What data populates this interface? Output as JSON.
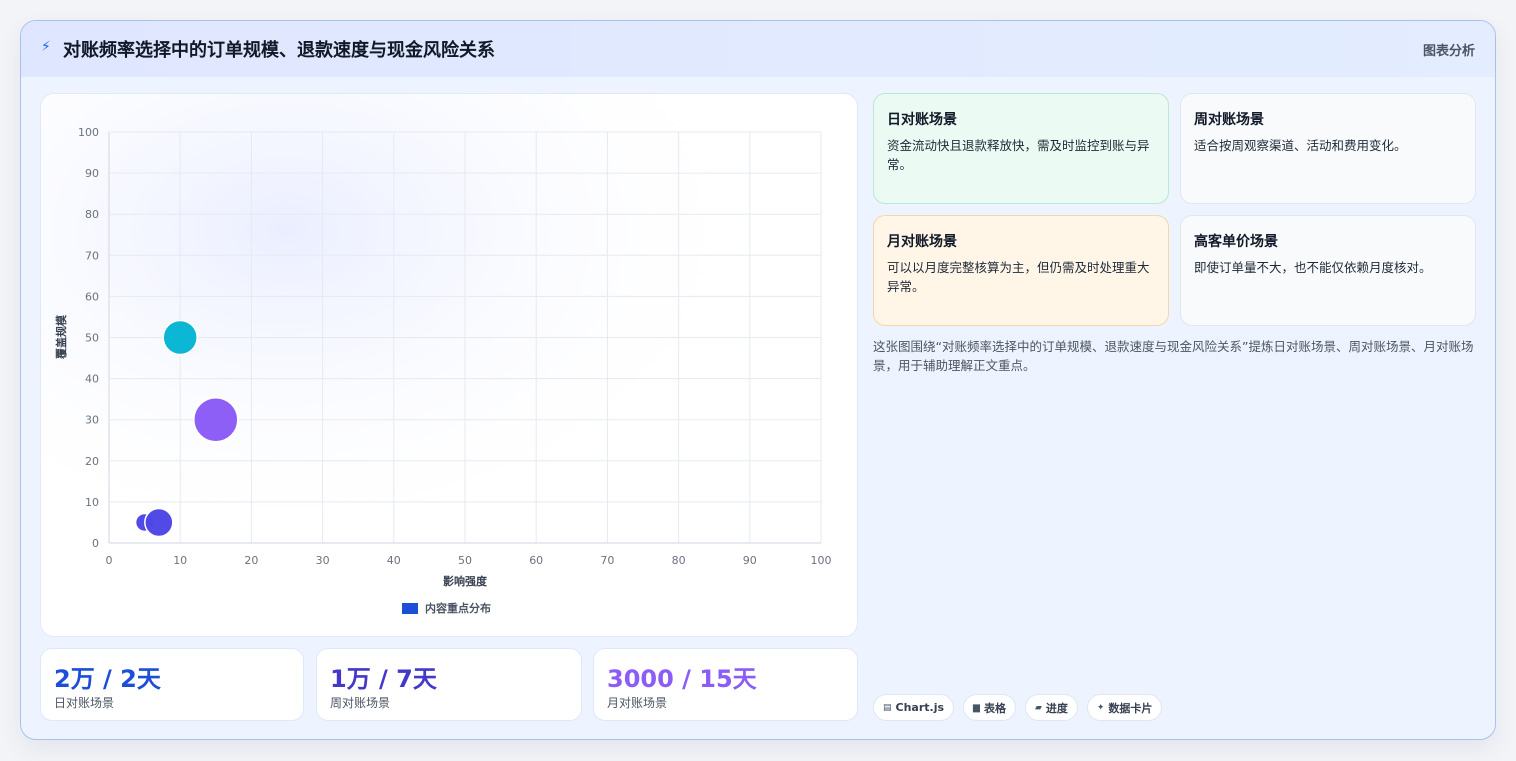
{
  "header": {
    "icon": "lightning-icon",
    "title": "对账频率选择中的订单规模、退款速度与现金风险关系",
    "badge": "图表分析"
  },
  "chart_data": {
    "type": "scatter",
    "xlabel": "影响强度",
    "ylabel": "覆盖规模",
    "xlim": [
      0,
      100
    ],
    "ylim": [
      0,
      100
    ],
    "xticks": [
      "0",
      "10",
      "20",
      "30",
      "40",
      "50",
      "60",
      "70",
      "80",
      "90",
      "100"
    ],
    "yticks": [
      "0",
      "10",
      "20",
      "30",
      "40",
      "50",
      "60",
      "70",
      "80",
      "90",
      "100"
    ],
    "grid": true,
    "legend_position": "bottom",
    "series": [
      {
        "name": "内容重点分布",
        "legend_color": "#1d4ed8",
        "points": [
          {
            "x": 5,
            "y": 5,
            "r": 9,
            "color": "#4f46e5"
          },
          {
            "x": 7,
            "y": 5,
            "r": 14,
            "color": "#4f46e5"
          },
          {
            "x": 10,
            "y": 50,
            "r": 17,
            "color": "#06b6d4"
          },
          {
            "x": 15,
            "y": 30,
            "r": 22,
            "color": "#8b5cf6"
          }
        ]
      }
    ]
  },
  "stats": [
    {
      "value": "2万 / 2天",
      "label": "日对账场景",
      "color": "#1d4ed8"
    },
    {
      "value": "1万 / 7天",
      "label": "周对账场景",
      "color": "#4338ca"
    },
    {
      "value": "3000 / 15天",
      "label": "月对账场景",
      "color": "#8b5cf6"
    }
  ],
  "scenes": [
    {
      "title": "日对账场景",
      "desc": "资金流动快且退款释放快，需及时监控到账与异常。"
    },
    {
      "title": "周对账场景",
      "desc": "适合按周观察渠道、活动和费用变化。"
    },
    {
      "title": "月对账场景",
      "desc": "可以以月度完整核算为主，但仍需及时处理重大异常。"
    },
    {
      "title": "高客单价场景",
      "desc": "即使订单量不大，也不能仅依赖月度核对。"
    }
  ],
  "summary": "这张图围绕“对账频率选择中的订单规模、退款速度与现金风险关系”提炼日对账场景、周对账场景、月对账场景，用于辅助理解正文重点。",
  "tags": [
    {
      "icon": "chart-icon",
      "label": "Chart.js"
    },
    {
      "icon": "table-icon",
      "label": "表格"
    },
    {
      "icon": "progress-icon",
      "label": "进度"
    },
    {
      "icon": "sparkle-icon",
      "label": "数据卡片"
    }
  ],
  "colors": {
    "accent": "#2563eb",
    "header_bg": "#dfe6ff",
    "panel_bg": "#eef4ff",
    "green_card": "#ebfaf2",
    "amber_card": "#fff6e8"
  }
}
